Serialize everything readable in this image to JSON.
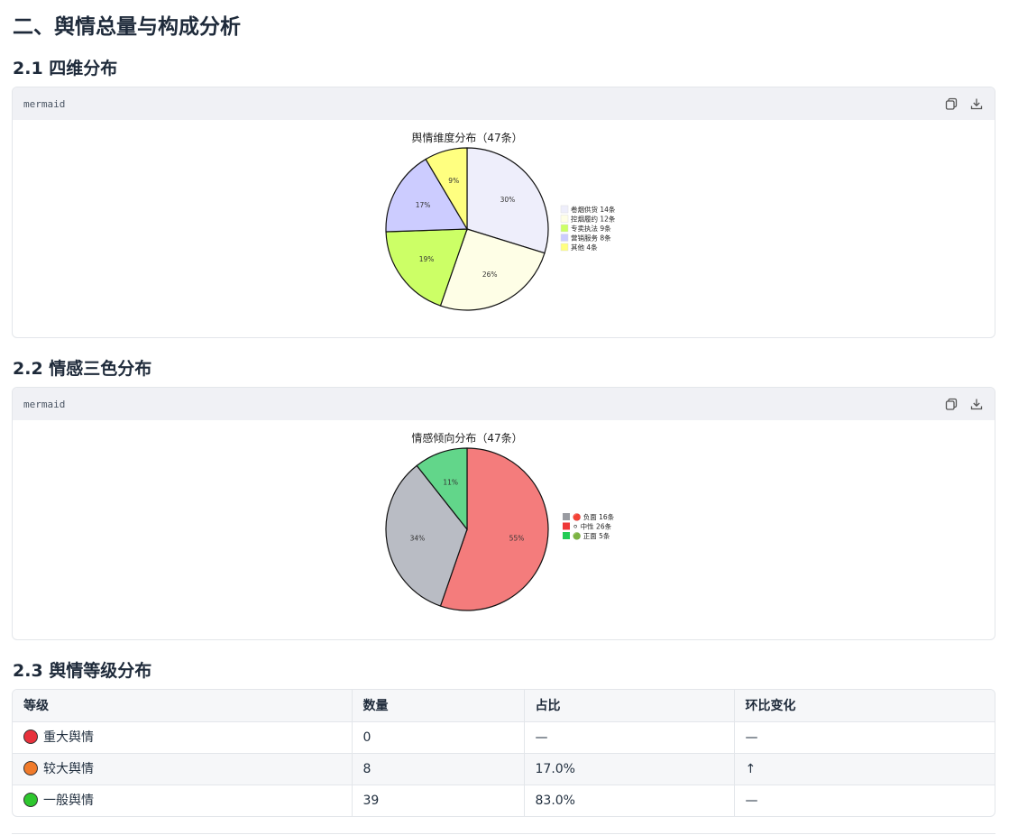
{
  "section_title": "二、舆情总量与构成分析",
  "s21_title": "2.1 四维分布",
  "s22_title": "2.2 情感三色分布",
  "s23_title": "2.3 舆情等级分布",
  "code_lang": "mermaid",
  "icons": {
    "copy": "copy-icon",
    "download": "download-icon"
  },
  "chart_data": [
    {
      "type": "pie",
      "title": "舆情维度分布（47条）",
      "legend_position": "right",
      "slices": [
        {
          "label": "卷烟供货 14条",
          "value": 14,
          "pct_label": "30%",
          "color": "#eeeefb"
        },
        {
          "label": "控烟履约 12条",
          "value": 12,
          "pct_label": "26%",
          "color": "#fefee6"
        },
        {
          "label": "专卖执法 9条",
          "value": 9,
          "pct_label": "19%",
          "color": "#ccff66"
        },
        {
          "label": "营销服务 8条",
          "value": 8,
          "pct_label": "17%",
          "color": "#ccccff"
        },
        {
          "label": "其他 4条",
          "value": 4,
          "pct_label": "9%",
          "color": "#ffff80"
        }
      ]
    },
    {
      "type": "pie",
      "title": "情感倾向分布（47条）",
      "legend_position": "right",
      "slices": [
        {
          "label": "🔴 负面 16条",
          "value": 26,
          "pct_label": "55%",
          "color": "#f47c7c",
          "legend_color": "#999ba1"
        },
        {
          "label": "⚪ 中性 26条",
          "value": 16,
          "pct_label": "34%",
          "color": "#b9bcc4",
          "legend_color": "#ee3838"
        },
        {
          "label": "🟢 正面 5条",
          "value": 5,
          "pct_label": "11%",
          "color": "#62d68a",
          "legend_color": "#22cc55"
        }
      ]
    }
  ],
  "table": {
    "headers": [
      "等级",
      "数量",
      "占比",
      "环比变化"
    ],
    "rows": [
      {
        "dot_color": "#e8323c",
        "level": "重大舆情",
        "count": "0",
        "ratio": "—",
        "change": "—"
      },
      {
        "dot_color": "#f07a2a",
        "level": "较大舆情",
        "count": "8",
        "ratio": "17.0%",
        "change": "↑"
      },
      {
        "dot_color": "#2ec72e",
        "level": "一般舆情",
        "count": "39",
        "ratio": "83.0%",
        "change": "—"
      }
    ]
  }
}
